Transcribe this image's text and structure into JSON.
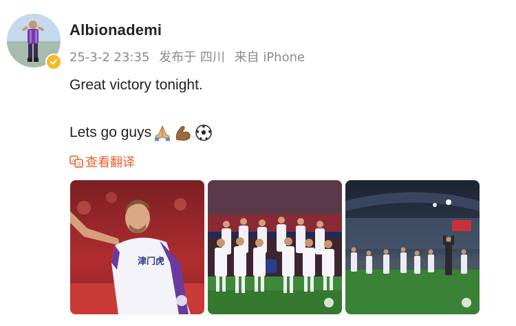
{
  "post": {
    "username": "Albionademi",
    "date": "25-3-2 23:35",
    "posted_from": "发布于 四川",
    "device": "来自 iPhone",
    "text_line1": "Great victory tonight.",
    "text_line2": "Lets go guys",
    "emojis": [
      "folded-hands",
      "flexed-biceps",
      "soccer-ball"
    ],
    "translate_label": "查看翻译",
    "photo_labels": [
      "津门虎"
    ]
  },
  "colors": {
    "translate_accent": "#e8612c",
    "verified_badge": "#f6b928",
    "meta_text": "#8a8a8a"
  }
}
